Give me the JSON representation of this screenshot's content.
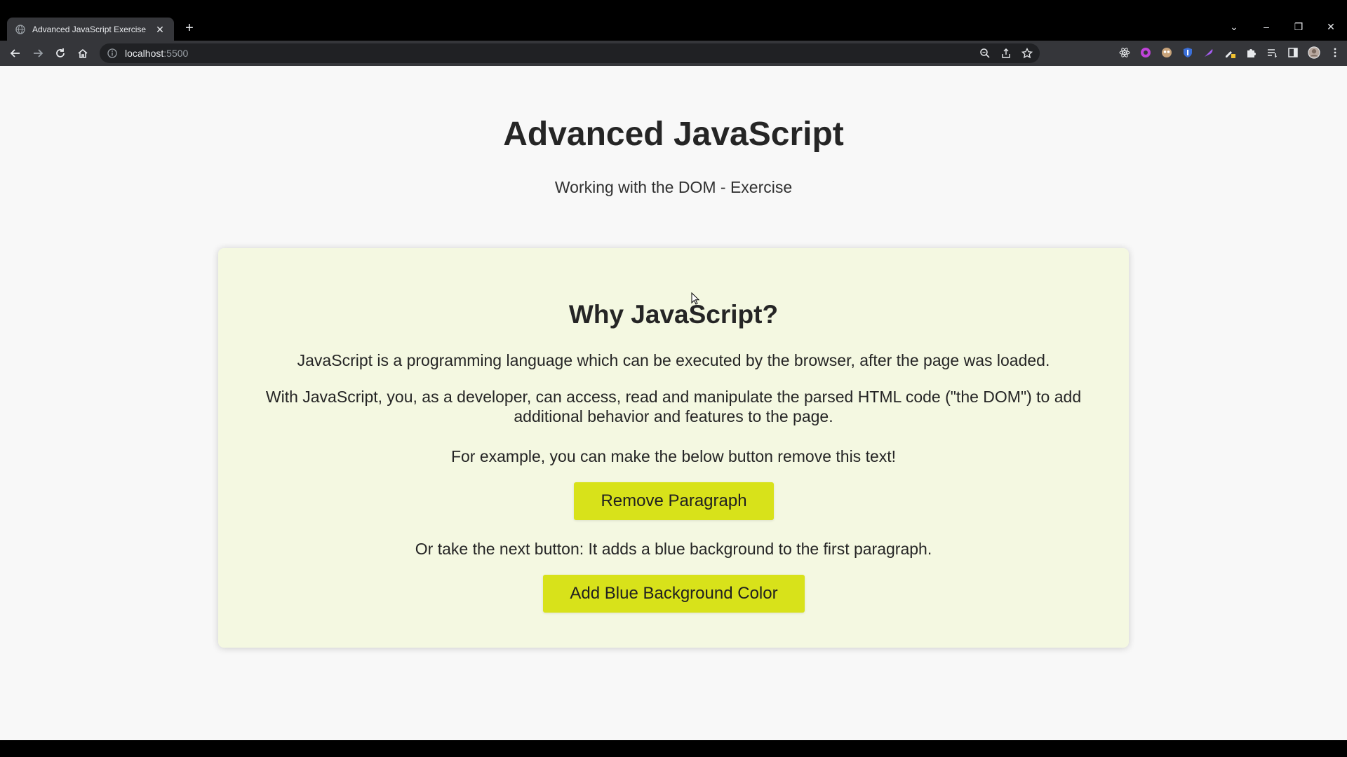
{
  "browser": {
    "tab_title": "Advanced JavaScript Exercise",
    "url_host": "localhost",
    "url_port": ":5500"
  },
  "page": {
    "title": "Advanced JavaScript",
    "subtitle": "Working with the DOM - Exercise"
  },
  "card": {
    "heading": "Why JavaScript?",
    "paragraph1": "JavaScript is a programming language which can be executed by the browser, after the page was loaded.",
    "paragraph2": "With JavaScript, you, as a developer, can access, read and manipulate the parsed HTML code (\"the DOM\") to add additional behavior and features to the page.",
    "paragraph3": "For example, you can make the below button remove this text!",
    "button1_label": "Remove Paragraph",
    "paragraph4": "Or take the next button: It adds a blue background to the first paragraph.",
    "button2_label": "Add Blue Background Color",
    "accent_color": "#d8e21a",
    "card_background": "#f4f8e1"
  }
}
